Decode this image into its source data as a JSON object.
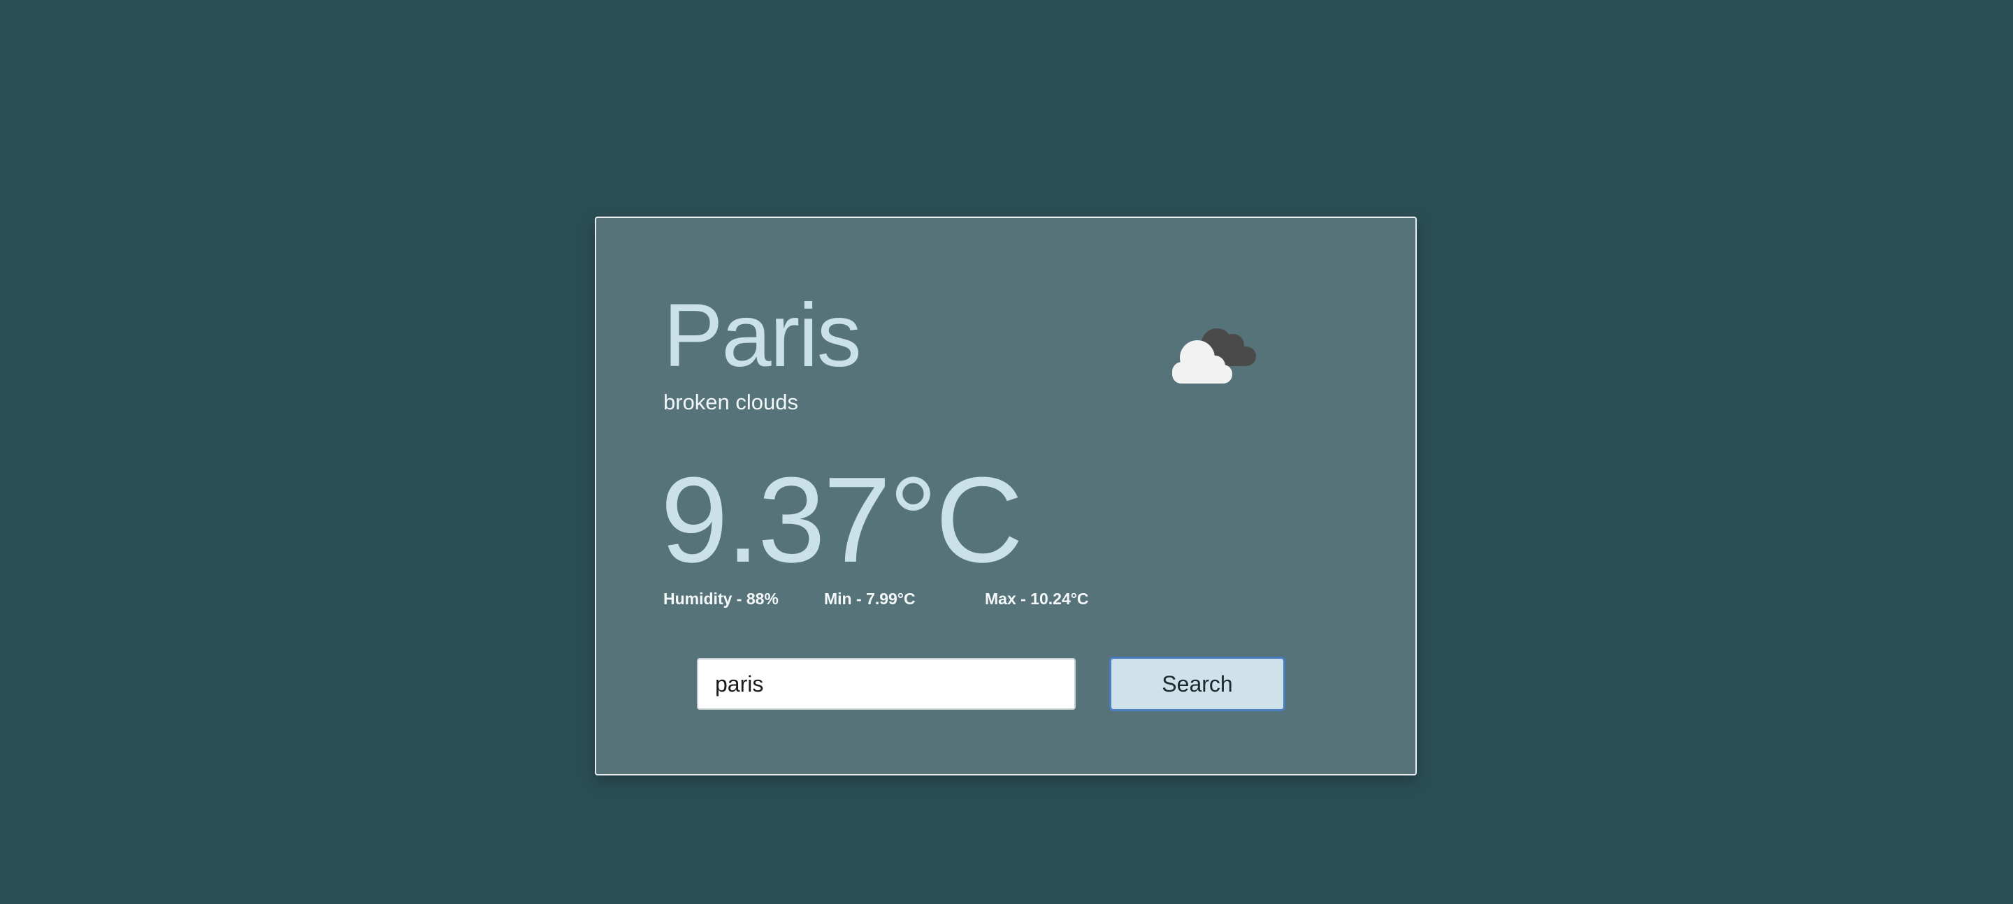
{
  "weather": {
    "city": "Paris",
    "description": "broken clouds",
    "temperature": "9.37°C",
    "icon": "broken-clouds-icon"
  },
  "stats": {
    "humidity": "Humidity - 88%",
    "min": "Min - 7.99°C",
    "max": "Max - 10.24°C"
  },
  "search": {
    "value": "paris",
    "button_label": "Search"
  },
  "colors": {
    "background": "#2b4e55",
    "card": "#557378",
    "accent_text": "#cbe1e8",
    "button": "#cfe2ea",
    "button_focus_border": "#4a7ec4"
  }
}
